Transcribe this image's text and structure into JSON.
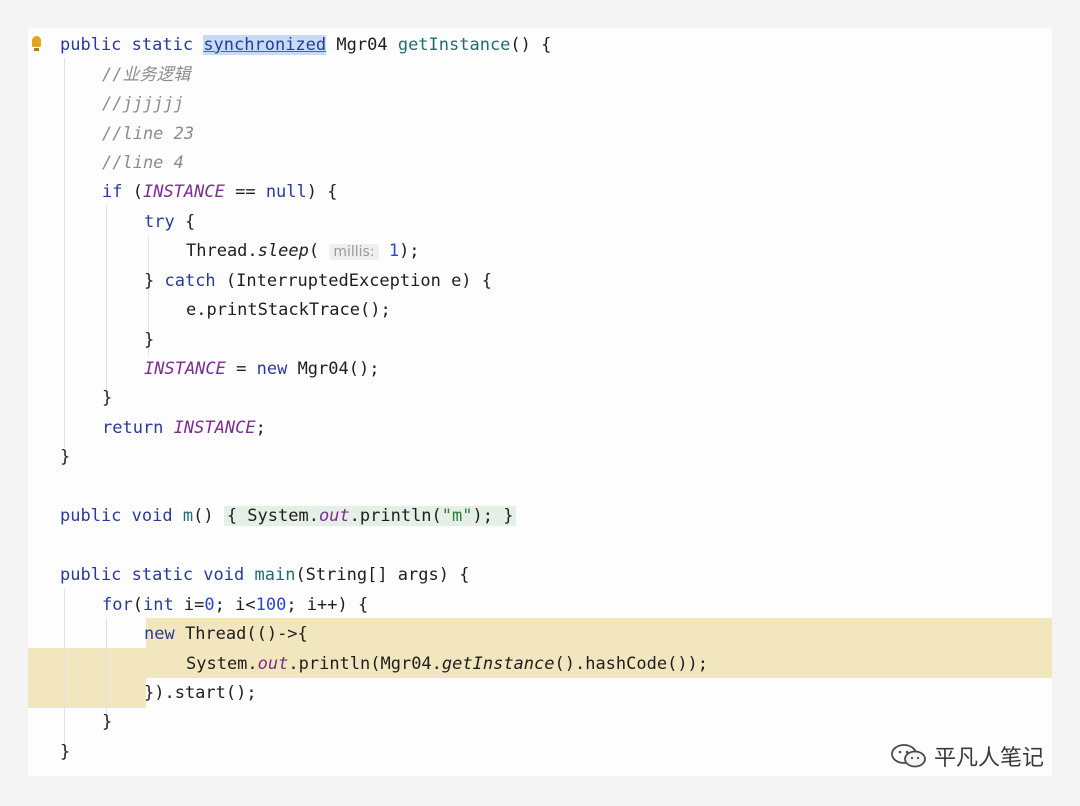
{
  "watermark": "平凡人笔记",
  "code": {
    "l1": {
      "kw": "public static",
      "sel": "synchronized",
      "type": "Mgr04",
      "method": "getInstance",
      "rest": "() {"
    },
    "l2": "//业务逻辑",
    "l3": "//jjjjjj",
    "l4": "//line 23",
    "l5": "//line 4",
    "l6": {
      "kw": "if",
      "open": " (",
      "field": "INSTANCE",
      "op": " == ",
      "null": "null",
      "rest": ") {"
    },
    "l7": {
      "kw": "try",
      "rest": " {"
    },
    "l8": {
      "cls": "Thread.",
      "method": "sleep",
      "open": "(",
      "hint": "millis:",
      "num": "1",
      "rest": ");"
    },
    "l9": {
      "brace": "} ",
      "kw": "catch",
      "rest": " (InterruptedException e) {"
    },
    "l10": "e.printStackTrace();",
    "l11": "}",
    "l12": {
      "field": "INSTANCE",
      "op": " = ",
      "kw": "new",
      "rest": " Mgr04();"
    },
    "l13": "}",
    "l14": {
      "kw": "return",
      "field": "INSTANCE",
      "rest": ";"
    },
    "l15": "}",
    "l16": {
      "kw": "public void",
      "method": "m",
      "paren": "() ",
      "fold": "{ System.",
      "out": "out",
      "call": ".println(",
      "str": "\"m\"",
      "end": "); }"
    },
    "l17": {
      "kw": "public static void",
      "method": "main",
      "rest": "(String[] args) {"
    },
    "l18": {
      "kw": "for",
      "open": "(",
      "kw2": "int",
      "a": " i=",
      "n0": "0",
      "b": "; i<",
      "n1": "100",
      "c": "; i++) {"
    },
    "l19": {
      "kw": "new",
      "rest": " Thread(()->{"
    },
    "l20": {
      "a": "System.",
      "out": "out",
      "b": ".println(Mgr04.",
      "m": "getInstance",
      "c": "().hashCode());"
    },
    "l21": "}).start();",
    "l22": "}",
    "l23": "}"
  }
}
